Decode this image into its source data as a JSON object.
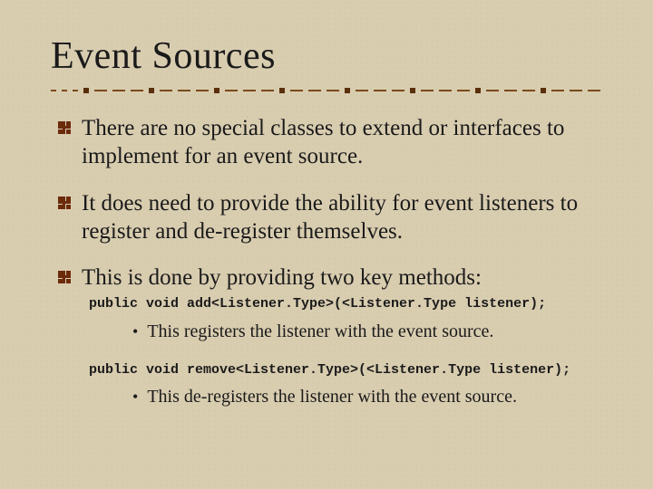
{
  "title": "Event Sources",
  "bullets": {
    "b1": "There are no special classes to extend or interfaces to implement for an event source.",
    "b2": "It does need to provide the ability for event listeners to register and de-register themselves.",
    "b3": "This is done by providing two key methods:"
  },
  "code": {
    "c1": "public void add<Listener.Type>(<Listener.Type listener);",
    "c2": "public void remove<Listener.Type>(<Listener.Type listener);"
  },
  "sub": {
    "s1": "This registers the listener with the event source.",
    "s2": "This de-registers the listener with the event source."
  }
}
